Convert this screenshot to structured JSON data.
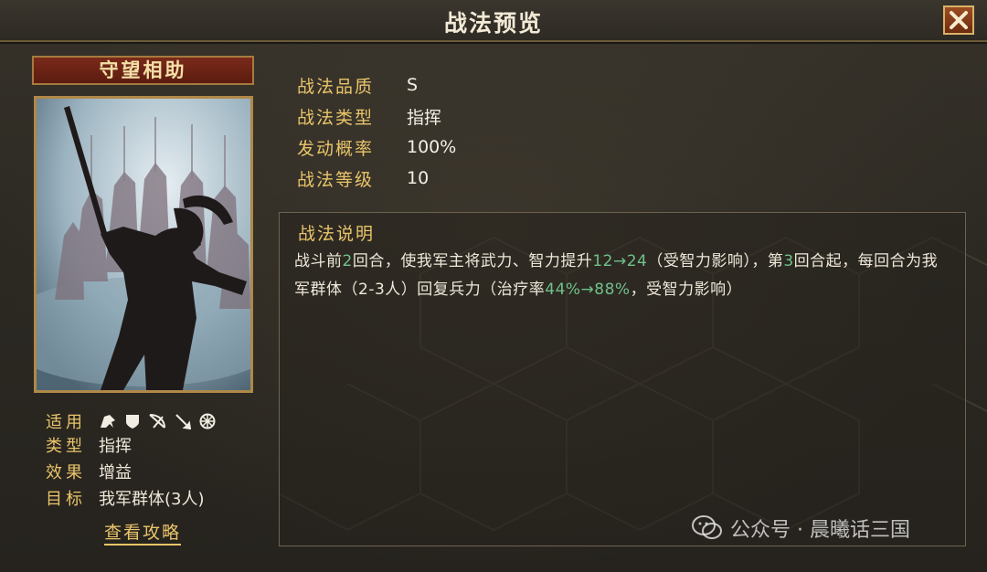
{
  "header": {
    "title": "战法预览"
  },
  "skill": {
    "name": "守望相助",
    "applicable_label": "适用",
    "applicable_icons": [
      "cavalry-icon",
      "shield-icon",
      "bow-icon",
      "spear-icon",
      "wheel-icon"
    ],
    "type_label": "类型",
    "type_value": "指挥",
    "effect_label": "效果",
    "effect_value": "增益",
    "target_label": "目标",
    "target_value": "我军群体(3人)",
    "guide_link": "查看攻略"
  },
  "attributes": [
    {
      "label": "战法品质",
      "value": "S"
    },
    {
      "label": "战法类型",
      "value": "指挥"
    },
    {
      "label": "发动概率",
      "value": "100%"
    },
    {
      "label": "战法等级",
      "value": "10"
    }
  ],
  "description": {
    "title": "战法说明",
    "p1": "战斗前",
    "n1": "2",
    "p2": "回合，使我军主将武力、智力提升",
    "n2": "12→24",
    "p3": "（受智力影响），第",
    "n3": "3",
    "p4": "回合起，每回合为我军群体（2-3人）回复兵力（治疗率",
    "n4": "44%→88%",
    "p5": "，受智力影响）"
  },
  "watermark": {
    "text": "公众号 · 晨曦话三国"
  },
  "colors": {
    "gold": "#e9c46a",
    "highlight": "#6fc18a",
    "banner_red": "#7a2a1a"
  }
}
